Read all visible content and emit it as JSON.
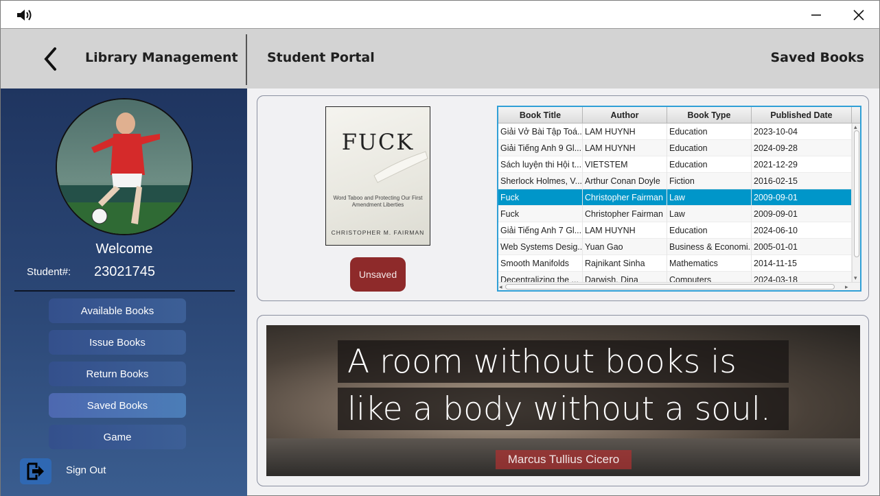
{
  "window": {
    "sound_icon": "speaker-icon",
    "minimize_icon": "minimize-icon",
    "close_icon": "close-icon"
  },
  "header": {
    "back_icon": "chevron-left-icon",
    "app_title": "Library Management",
    "section_title": "Student Portal",
    "page_title": "Saved Books"
  },
  "sidebar": {
    "welcome": "Welcome",
    "student_label": "Student#:",
    "student_number": "23021745",
    "nav": [
      {
        "label": "Available Books"
      },
      {
        "label": "Issue Books"
      },
      {
        "label": "Return Books"
      },
      {
        "label": "Saved Books"
      },
      {
        "label": "Game"
      }
    ],
    "active_nav": "Saved Books",
    "signout_label": "Sign Out",
    "signout_icon": "sign-out-icon"
  },
  "book_preview": {
    "cover_title": "FUCK",
    "cover_subtitle": "Word Taboo and Protecting Our First Amendment Liberties",
    "cover_author": "CHRISTOPHER M. FAIRMAN",
    "unsave_label": "Unsaved"
  },
  "table": {
    "columns": [
      "Book Title",
      "Author",
      "Book Type",
      "Published Date"
    ],
    "rows": [
      [
        "Giải Vở Bài Tập Toá...",
        "LAM HUYNH",
        "Education",
        "2023-10-04"
      ],
      [
        "Giải Tiếng Anh 9 Gl...",
        "LAM HUYNH",
        "Education",
        "2024-09-28"
      ],
      [
        "Sách luyện thi Hội t...",
        "VIETSTEM",
        "Education",
        "2021-12-29"
      ],
      [
        "Sherlock Holmes, V...",
        "Arthur Conan Doyle",
        "Fiction",
        "2016-02-15"
      ],
      [
        "Fuck",
        "Christopher Fairman",
        "Law",
        "2009-09-01"
      ],
      [
        "Fuck",
        "Christopher Fairman",
        "Law",
        "2009-09-01"
      ],
      [
        "Giải Tiếng Anh 7 Gl...",
        "LAM HUYNH",
        "Education",
        "2024-06-10"
      ],
      [
        "Web Systems Desig...",
        "Yuan Gao",
        "Business & Economi...",
        "2005-01-01"
      ],
      [
        "Smooth Manifolds",
        "Rajnikant Sinha",
        "Mathematics",
        "2014-11-15"
      ],
      [
        "Decentralizing the ...",
        "Darwish, Dina",
        "Computers",
        "2024-03-18"
      ]
    ],
    "selected_row_index": 4
  },
  "quote": {
    "line1": "A room without books is",
    "line2": "like a body without a soul.",
    "author": "Marcus Tullius Cicero"
  },
  "colors": {
    "sidebar_top": "#1f3560",
    "sidebar_bottom": "#3a5d8f",
    "nav_button": "#3c5f96",
    "selected_row": "#0096c9",
    "unsave_button": "#8e2a2a",
    "header_bg": "#d3d3d3"
  }
}
